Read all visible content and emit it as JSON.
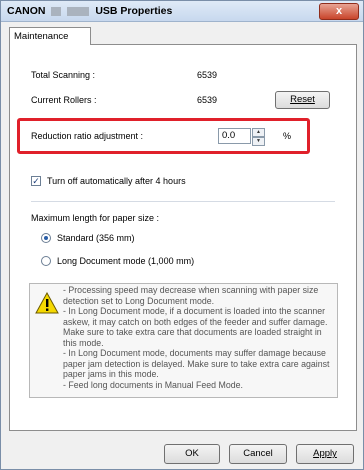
{
  "window": {
    "title_prefix": "CANON",
    "title_suffix": "USB Properties",
    "close_glyph": "x"
  },
  "tab": {
    "label": "Maintenance"
  },
  "stats": {
    "total_scanning_label": "Total Scanning :",
    "total_scanning_value": "6539",
    "current_rollers_label": "Current Rollers :",
    "current_rollers_value": "6539",
    "reset_label": "Reset"
  },
  "reduction": {
    "label": "Reduction ratio adjustment :",
    "value": "0.0",
    "unit": "%"
  },
  "auto_off": {
    "label": "Turn off automatically after 4 hours",
    "checked": true
  },
  "paper_size": {
    "heading": "Maximum length for paper size :",
    "options": [
      {
        "label": "Standard (356 mm)",
        "selected": true
      },
      {
        "label": "Long Document mode (1,000 mm)",
        "selected": false
      }
    ]
  },
  "warning": {
    "icon": "warning-icon",
    "text": "- Processing speed may decrease when scanning with paper size detection set to Long Document mode.\n- In Long Document mode, if a document is loaded into the scanner askew, it may catch on both edges of the feeder and suffer damage. Make sure to take extra care that documents are loaded straight in this mode.\n- In Long Document mode, documents may suffer damage because paper jam detection is delayed. Make sure to take extra care against paper jams in this mode.\n- Feed long documents in Manual Feed Mode."
  },
  "footer": {
    "ok_label": "OK",
    "cancel_label": "Cancel",
    "apply_label": "Apply"
  },
  "colors": {
    "highlight": "#e0202a",
    "close_button": "#c8442a",
    "warning_yellow": "#f5d800"
  }
}
